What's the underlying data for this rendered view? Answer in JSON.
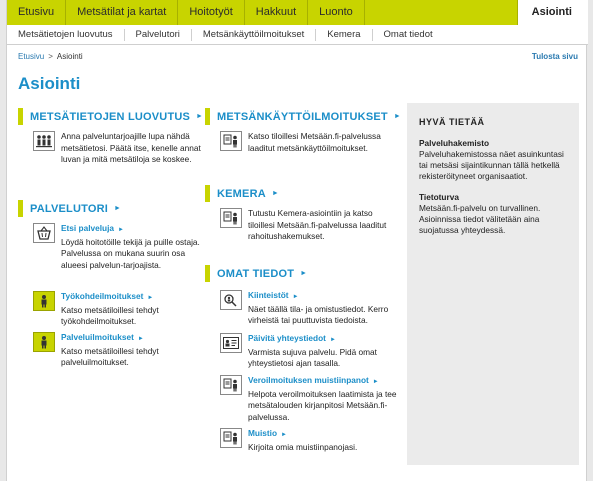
{
  "topnav": [
    "Etusivu",
    "Metsätilat ja kartat",
    "Hoitotyöt",
    "Hakkuut",
    "Luonto"
  ],
  "topnav_active": "Asiointi",
  "subnav": [
    "Metsätietojen luovutus",
    "Palvelutori",
    "Metsänkäyttöilmoitukset",
    "Kemera",
    "Omat tiedot"
  ],
  "breadcrumb": {
    "home": "Etusivu",
    "current": "Asiointi",
    "print": "Tulosta sivu"
  },
  "page_title": "Asiointi",
  "sections": {
    "luovutus": {
      "title": "METSÄTIETOJEN LUOVUTUS",
      "text": "Anna palveluntarjoajille lupa nähdä metsätietosi. Päätä itse, kenelle annat luvan ja mitä metsätiloja se koskee."
    },
    "palvelutori": {
      "title": "PALVELUTORI",
      "items": [
        {
          "title": "Etsi palveluja",
          "text": "Löydä hoitotöille tekijä ja puille ostaja. Palvelussa on mukana suurin osa alueesi palvelun-tarjoajista."
        },
        {
          "title": "Työkohdeilmoitukset",
          "text": "Katso metsätiloillesi tehdyt työkohdeilmoitukset."
        },
        {
          "title": "Palveluilmoitukset",
          "text": "Katso metsätiloillesi tehdyt palveluilmoitukset."
        }
      ]
    },
    "mki": {
      "title": "METSÄNKÄYTTÖILMOITUKSET",
      "text": "Katso tiloillesi Metsään.fi-palvelussa laaditut metsänkäyttöilmoitukset."
    },
    "kemera": {
      "title": "KEMERA",
      "text": "Tutustu Kemera-asiointiin ja katso tiloillesi Metsään.fi-palvelussa laaditut rahoitushakemukset."
    },
    "omat": {
      "title": "OMAT TIEDOT",
      "items": [
        {
          "title": "Kiinteistöt",
          "text": "Näet täällä tila- ja omistustiedot. Kerro virheistä tai puuttuvista tiedoista."
        },
        {
          "title": "Päivitä yhteystiedot",
          "text": "Varmista sujuva palvelu. Pidä omat yhteystietosi ajan tasalla."
        },
        {
          "title": "Veroilmoituksen muistiinpanot",
          "text": "Helpota veroilmoituksen laatimista ja tee metsätalouden kirjanpitosi Metsään.fi-palvelussa."
        },
        {
          "title": "Muistio",
          "text": "Kirjoita omia muistiinpanojasi."
        }
      ]
    }
  },
  "side": {
    "heading": "HYVÄ TIETÄÄ",
    "blocks": [
      {
        "title": "Palveluhakemisto",
        "text": "Palveluhakemistossa näet asuinkuntasi tai metsäsi sijaintikunnan tällä hetkellä rekisteröityneet organisaatiot."
      },
      {
        "title": "Tietoturva",
        "text": "Metsään.fi-palvelu on turvallinen. Asioinnissa tiedot välitetään aina suojatussa yhteydessä."
      }
    ]
  },
  "arrow_glyph": "►",
  "colors": {
    "accent_green": "#c8d400",
    "link_blue": "#1b8ec8",
    "panel_gray": "#ebebeb"
  }
}
